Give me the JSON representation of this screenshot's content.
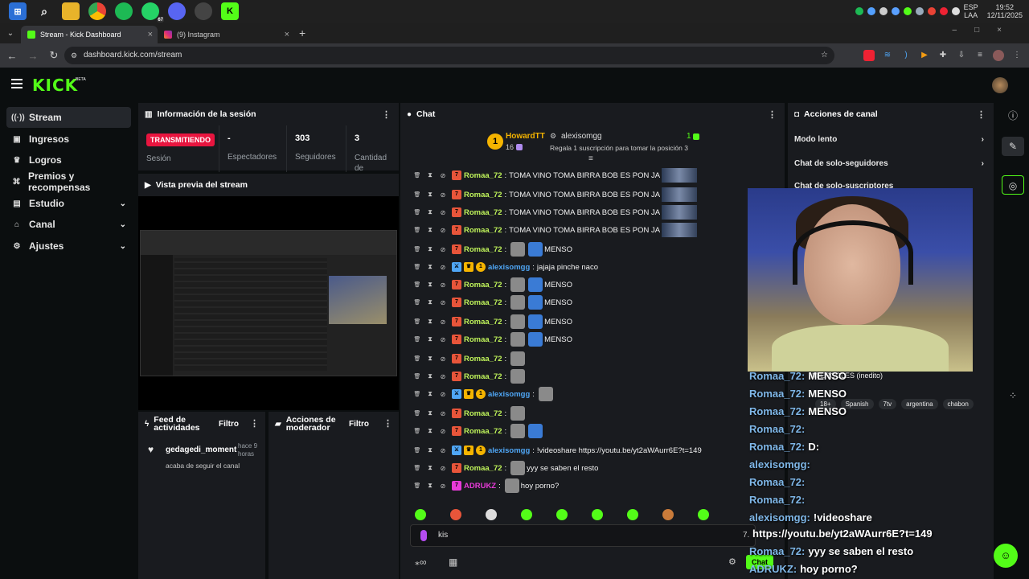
{
  "taskbar": {
    "lang": "ESP",
    "layout": "LAA",
    "time": "19:52",
    "date": "12/11/2025",
    "whatsapp_count": "67"
  },
  "browser": {
    "tabs": [
      {
        "label": "Stream - Kick Dashboard",
        "active": true
      },
      {
        "label": "(9) Instagram",
        "active": false
      }
    ],
    "new_tab": "+",
    "url": "dashboard.kick.com/stream"
  },
  "kick": {
    "logo": "KICK",
    "beta": "BETA"
  },
  "sidebar": {
    "items": [
      {
        "label": "Stream",
        "icon": "broadcast-icon",
        "active": true,
        "expandable": false
      },
      {
        "label": "Ingresos",
        "icon": "wallet-icon",
        "active": false,
        "expandable": false
      },
      {
        "label": "Logros",
        "icon": "trophy-icon",
        "active": false,
        "expandable": false
      },
      {
        "label": "Premios y recompensas",
        "icon": "gift-icon",
        "active": false,
        "expandable": false
      },
      {
        "label": "Estudio",
        "icon": "studio-icon",
        "active": false,
        "expandable": true
      },
      {
        "label": "Canal",
        "icon": "channel-icon",
        "active": false,
        "expandable": true
      },
      {
        "label": "Ajustes",
        "icon": "gear-icon",
        "active": false,
        "expandable": true
      }
    ]
  },
  "session": {
    "title": "Información de la sesión",
    "status": "TRANSMITIENDO",
    "session_label": "Sesión",
    "stats": [
      {
        "value": "-",
        "label": "Espectadores"
      },
      {
        "value": "303",
        "label": "Seguidores"
      },
      {
        "value": "3",
        "label": "Cantidad de suscripciones"
      }
    ]
  },
  "preview": {
    "title": "Vista previa del stream"
  },
  "feed": {
    "title": "Feed de actividades",
    "filter": "Filtro",
    "items": [
      {
        "user": "gedagedi_moment",
        "time": "hace 9 horas",
        "text": "acaba de seguir el canal"
      }
    ]
  },
  "mod_actions": {
    "title": "Acciones de moderador",
    "filter": "Filtro"
  },
  "chat": {
    "title": "Chat",
    "pinned": {
      "rank": "1",
      "leader": "HowardTT",
      "leader_count": "16",
      "user": "alexisomgg",
      "user_count": "1",
      "subtitle": "Regala 1 suscripción para tomar la posición 3"
    },
    "messages": [
      {
        "user": "Romaa_72",
        "text": "TOMA VINO TOMA BIRRA BOB ES PON JA",
        "thumb": true
      },
      {
        "user": "Romaa_72",
        "text": "TOMA VINO TOMA BIRRA BOB ES PON JA",
        "thumb": true
      },
      {
        "user": "Romaa_72",
        "text": "TOMA VINO TOMA BIRRA BOB ES PON JA",
        "thumb": true
      },
      {
        "user": "Romaa_72",
        "text": "TOMA VINO TOMA BIRRA BOB ES PON JA",
        "thumb": true
      },
      {
        "user": "Romaa_72",
        "text": "MENSO",
        "emotes": 2
      },
      {
        "user": "alexisomgg",
        "text": "jajaja pinche naco",
        "mod": true
      },
      {
        "user": "Romaa_72",
        "text": "MENSO",
        "emotes": 2
      },
      {
        "user": "Romaa_72",
        "text": "MENSO",
        "emotes": 2
      },
      {
        "user": "Romaa_72",
        "text": "MENSO",
        "emotes": 2
      },
      {
        "user": "Romaa_72",
        "text": "MENSO",
        "emotes": 2
      },
      {
        "user": "Romaa_72",
        "text": "",
        "emotes": 1
      },
      {
        "user": "Romaa_72",
        "text": "",
        "emotes": 1
      },
      {
        "user": "alexisomgg",
        "text": "",
        "mod": true,
        "emotes": 1
      },
      {
        "user": "Romaa_72",
        "text": "",
        "emotes": 1
      },
      {
        "user": "Romaa_72",
        "text": "",
        "emotes": 2
      },
      {
        "user": "alexisomgg",
        "text": "!videoshare https://youtu.be/yt2aWAurr6E?t=149",
        "mod": true
      },
      {
        "user": "Romaa_72",
        "text": "yyy  se saben el resto",
        "emotes": 1
      },
      {
        "user": "ADRUKZ",
        "text": "hoy porno?",
        "emotes": 1,
        "pink": true
      }
    ],
    "input_value": "kis",
    "send_label": "Chat"
  },
  "channel_actions": {
    "title": "Acciones de canal",
    "items": [
      "Modo lento",
      "Chat de solo-seguidores",
      "Chat de solo-suscriptores"
    ]
  },
  "overlay": {
    "stream_title": "MIERCOLES (inedito)",
    "tags": [
      "18+",
      "Spanish",
      "7tv",
      "argentina",
      "chabon"
    ],
    "lines": [
      {
        "user": "Romaa_72:",
        "text": "MENSO"
      },
      {
        "user": "Romaa_72:",
        "text": "MENSO"
      },
      {
        "user": "Romaa_72:",
        "text": "MENSO"
      },
      {
        "user": "Romaa_72:",
        "text": ""
      },
      {
        "user": "Romaa_72:",
        "text": "D:"
      },
      {
        "user": "alexisomgg:",
        "text": ""
      },
      {
        "user": "Romaa_72:",
        "text": ""
      },
      {
        "user": "Romaa_72:",
        "text": ""
      },
      {
        "user": "alexisomgg:",
        "text": "!videoshare"
      },
      {
        "user": "",
        "text": "https://youtu.be/yt2aWAurr6E?t=149"
      },
      {
        "user": "Romaa_72:",
        "text": "yyy  se saben el resto"
      },
      {
        "user": "ADRUKZ:",
        "text": "hoy porno?"
      }
    ]
  },
  "colors": {
    "kick_green": "#53fc18",
    "live_red": "#e8153f",
    "username_green": "#bff35a",
    "mod_blue": "#4fa6f5",
    "pink": "#e83ad9"
  }
}
